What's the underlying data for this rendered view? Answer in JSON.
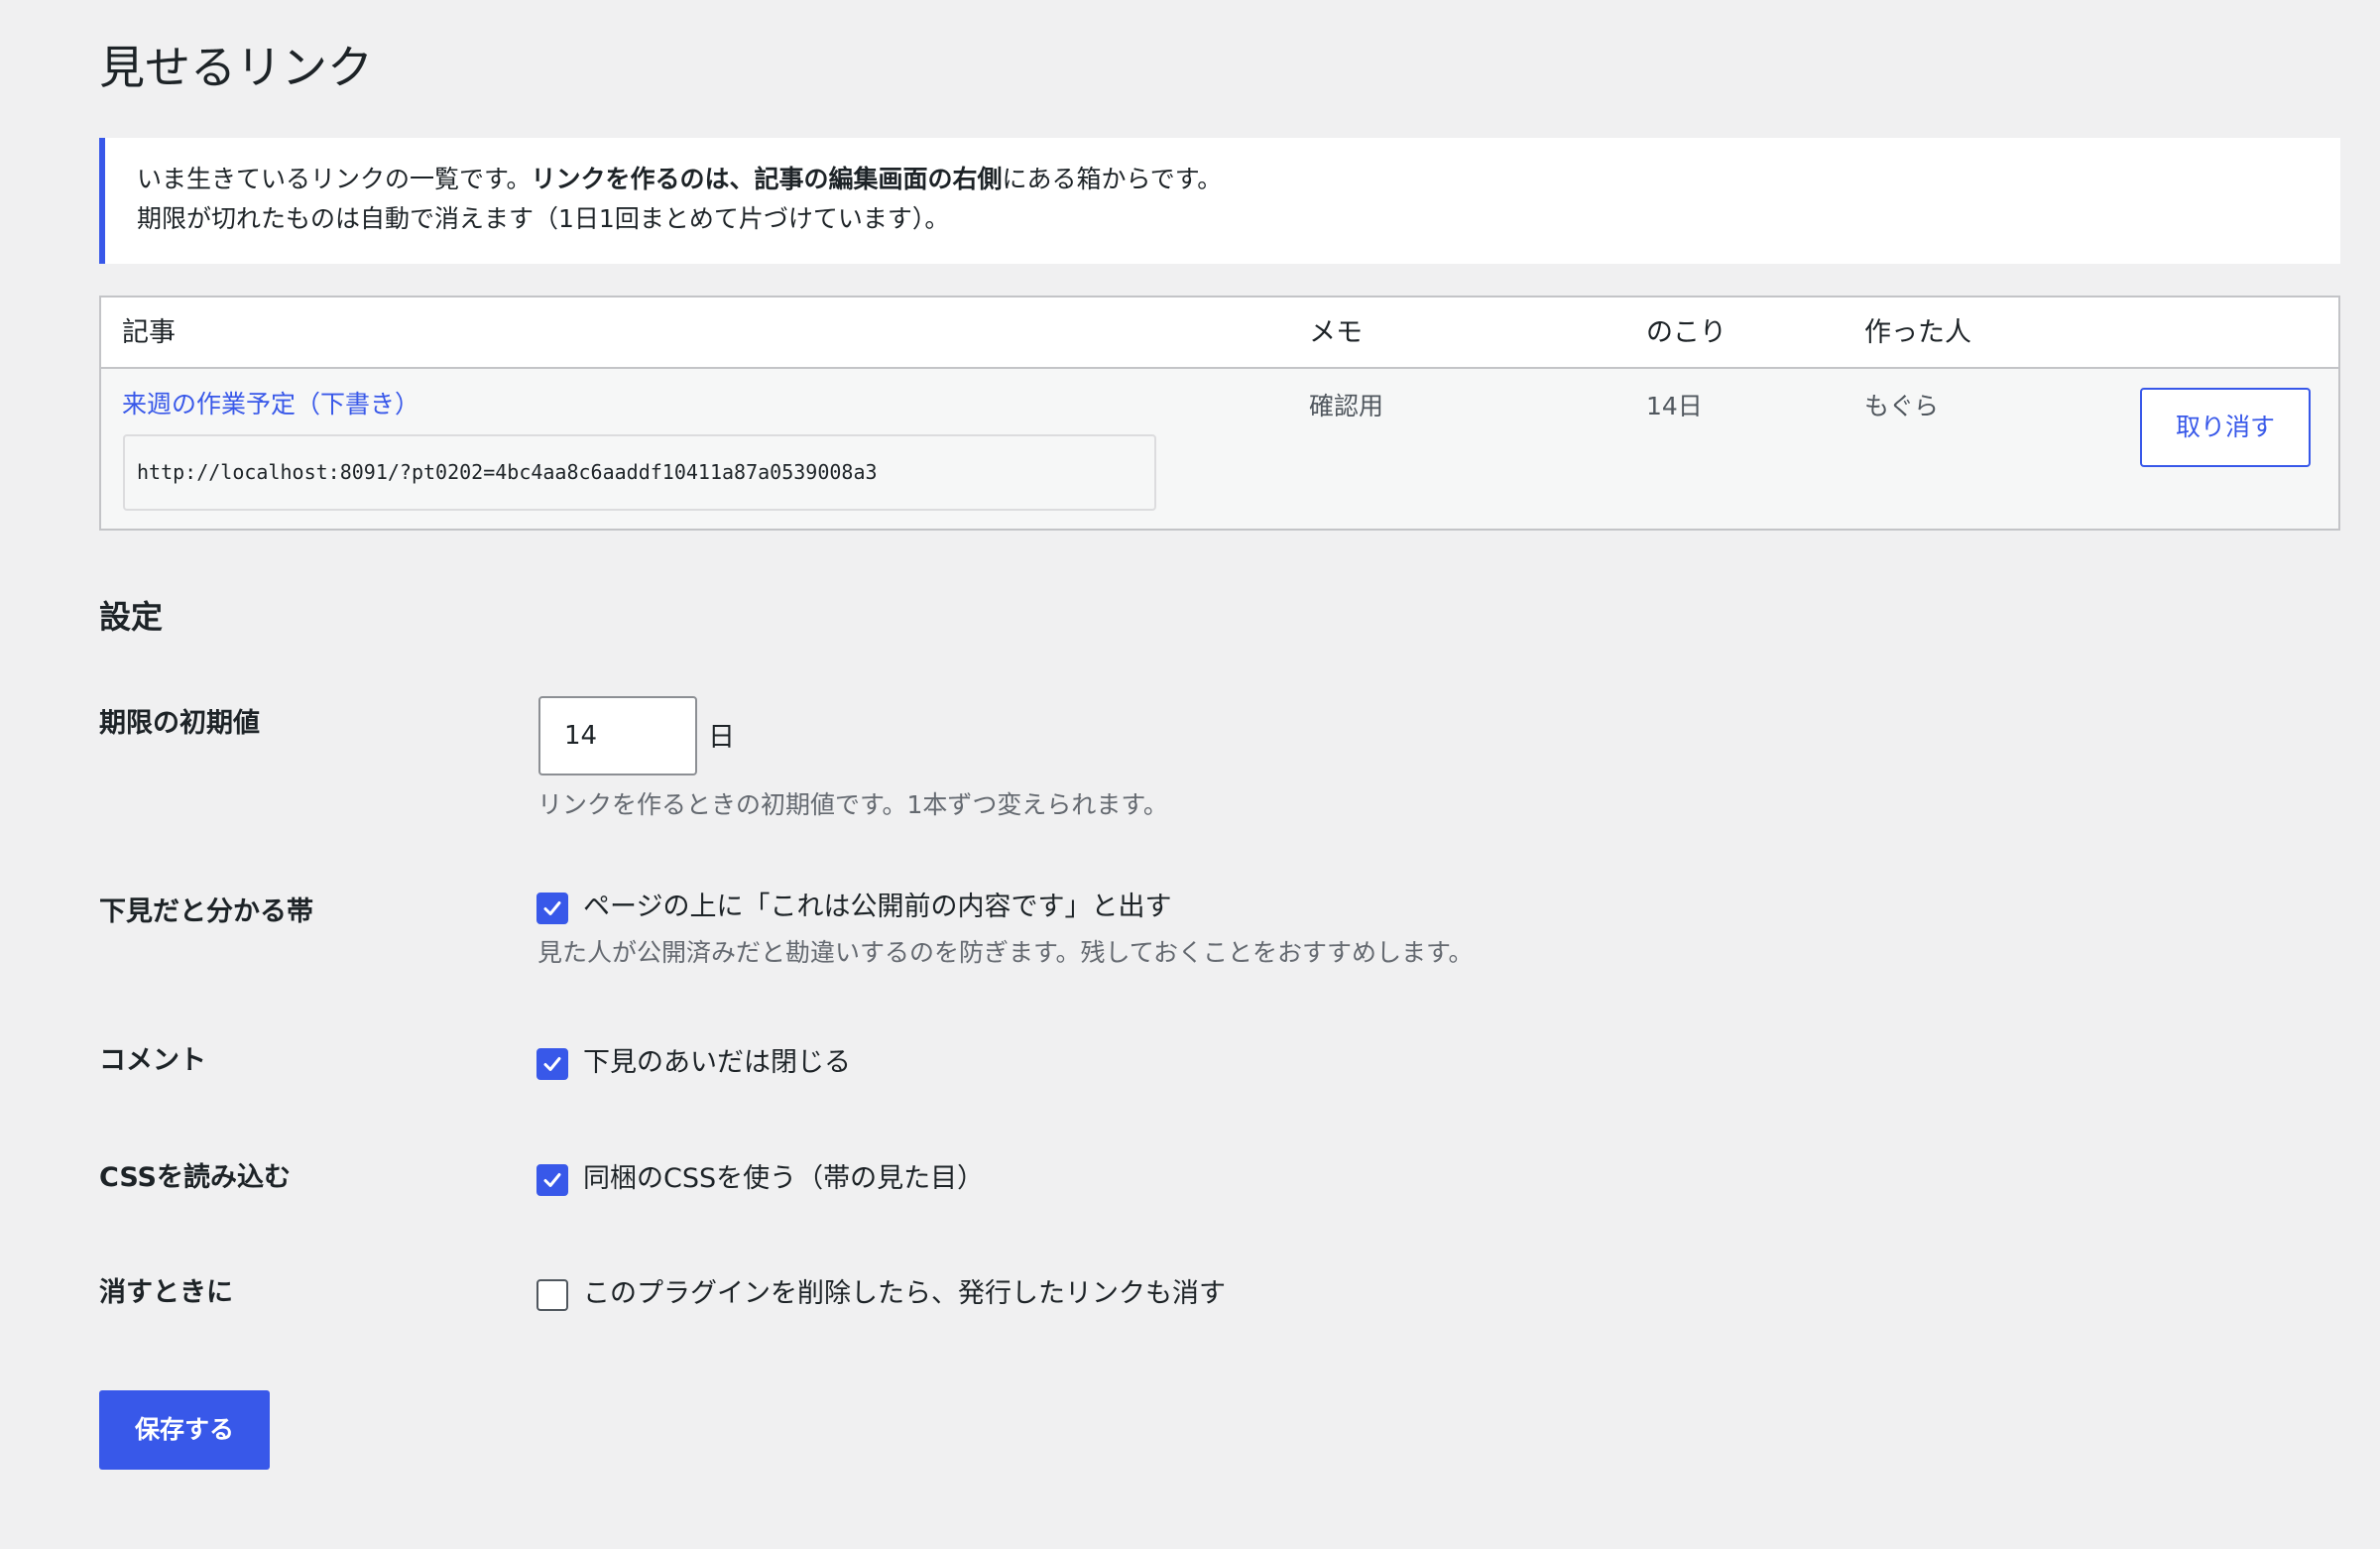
{
  "page": {
    "title": "見せるリンク"
  },
  "notice": {
    "line1_part1": "いま生きているリンクの一覧です。",
    "line1_bold": "リンクを作るのは、記事の編集画面の右側",
    "line1_part2": "にある箱からです。",
    "line2": "期限が切れたものは自動で消えます（1日1回まとめて片づけています）。"
  },
  "table": {
    "headers": {
      "post": "記事",
      "memo": "メモ",
      "remaining": "のこり",
      "author": "作った人"
    },
    "rows": [
      {
        "post_title": "来週の作業予定（下書き）",
        "url": "http://localhost:8091/?pt0202=4bc4aa8c6aaddf10411a87a0539008a3",
        "memo": "確認用",
        "remaining": "14日",
        "author": "もぐら",
        "revoke_label": "取り消す"
      }
    ]
  },
  "settings": {
    "title": "設定",
    "default_expiry": {
      "label": "期限の初期値",
      "value": "14",
      "unit": "日",
      "description": "リンクを作るときの初期値です。1本ずつ変えられます。"
    },
    "banner": {
      "label": "下見だと分かる帯",
      "checked": true,
      "option_label": "ページの上に「これは公開前の内容です」と出す",
      "description": "見た人が公開済みだと勘違いするのを防ぎます。残しておくことをおすすめします。"
    },
    "comments": {
      "label": "コメント",
      "checked": true,
      "option_label": "下見のあいだは閉じる"
    },
    "css": {
      "label": "CSSを読み込む",
      "checked": true,
      "option_label": "同梱のCSSを使う（帯の見た目）"
    },
    "uninstall": {
      "label": "消すときに",
      "checked": false,
      "option_label": "このプラグインを削除したら、発行したリンクも消す"
    },
    "save_label": "保存する"
  },
  "colors": {
    "accent": "#3858e9",
    "background": "#f0f0f1",
    "text": "#1d2327",
    "muted": "#646970"
  }
}
